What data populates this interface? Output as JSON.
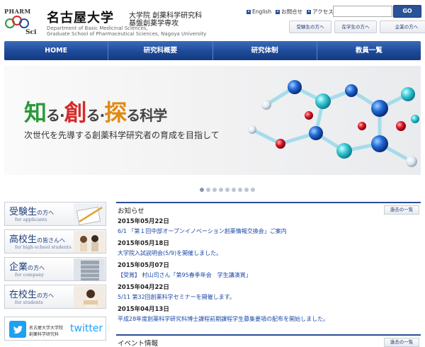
{
  "header": {
    "logo_top": "PHARM",
    "logo_bottom": "Sci",
    "university": "名古屋大学",
    "dept_line1": "大学院 創薬科学研究科",
    "dept_line2": "基盤創薬学専攻",
    "english_line1": "Department of Basic Medicinal Sciences,",
    "english_line2": "Graduate School of Pharmaceutical Sciences, Nagoya University",
    "links": [
      "English",
      "お問合せ",
      "アクセス"
    ],
    "search_placeholder": "",
    "go_label": "GO",
    "audience_links": [
      "受験生の方へ",
      "在学生の方へ",
      "企業の方へ"
    ]
  },
  "nav": [
    "HOME",
    "研究科概要",
    "研究体制",
    "教員一覧"
  ],
  "hero": {
    "kanji1": "知",
    "kanji2": "創",
    "kanji3": "探",
    "ru": "る",
    "dot": "·",
    "suffix": "る科学",
    "subtitle": "次世代を先導する創薬科学研究者の育成を目指して",
    "slide_count": 9,
    "active_slide": 1
  },
  "banners": [
    {
      "title": "受験生",
      "suffix": "の方へ",
      "sub": "for applicants"
    },
    {
      "title": "高校生",
      "suffix": "の皆さんへ",
      "sub": "for high-school students"
    },
    {
      "title": "企業",
      "suffix": "の方へ",
      "sub": "for company"
    },
    {
      "title": "在校生",
      "suffix": "の方へ",
      "sub": "for students"
    }
  ],
  "twitter": {
    "name1": "名古屋大学大学院",
    "name2": "創薬科学研究科",
    "word": "twitter"
  },
  "news": {
    "heading": "お知らせ",
    "past_label": "過去の一覧",
    "items": [
      {
        "date": "2015年05月22日",
        "text": "6/1 「第１回中部オープンイノベーション創薬情報交換会」ご案内"
      },
      {
        "date": "2015年05月18日",
        "text": "大学院入試説明会(5/9)を開催しました。"
      },
      {
        "date": "2015年05月07日",
        "text": "【受賞】 村山司さん「第95春季年会　学生講演賞」"
      },
      {
        "date": "2015年04月22日",
        "text": "5/11 第32回創薬科学セミナーを開催します。"
      },
      {
        "date": "2015年04月13日",
        "text": "平成28年度創薬科学研究科博士課程前期課程学生募集要項の配布を開始しました。"
      }
    ]
  },
  "events": {
    "heading": "イベント情報",
    "past_label": "過去の一覧"
  },
  "colors": {
    "brand_blue": "#2a4f95",
    "green": "#2a9a3a",
    "red": "#d42a2a",
    "orange": "#e08a12",
    "twitter": "#1da1f2"
  }
}
